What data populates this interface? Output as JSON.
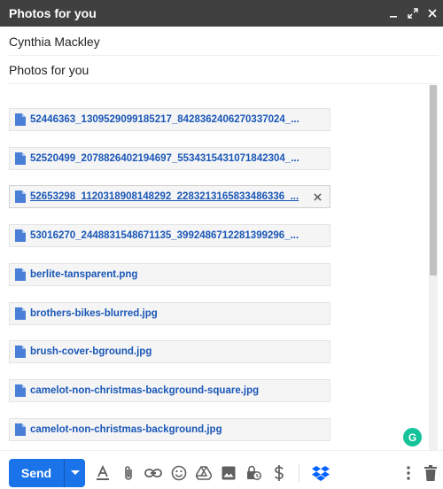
{
  "window": {
    "title": "Photos for you"
  },
  "compose": {
    "to": "Cynthia Mackley",
    "subject": "Photos for you"
  },
  "attachments": [
    {
      "name": "52446363_1309529099185217_8428362406270337024_..."
    },
    {
      "name": "52520499_2078826402194697_5534315431071842304_..."
    },
    {
      "name": "52653298_1120318908148292_2283213165833486336_..."
    },
    {
      "name": "53016270_2448831548671135_3992486712281399296_..."
    },
    {
      "name": "berlite-tansparent.png"
    },
    {
      "name": "brothers-bikes-blurred.jpg"
    },
    {
      "name": "brush-cover-bground.jpg"
    },
    {
      "name": "camelot-non-christmas-background-square.jpg"
    },
    {
      "name": "camelot-non-christmas-background.jpg"
    }
  ],
  "toolbar": {
    "send_label": "Send",
    "grammarly_label": "G"
  },
  "colors": {
    "titlebar": "#404040",
    "send": "#1a73e8",
    "link": "#1a57b7",
    "grammarly": "#15c39a",
    "dropbox": "#0061fe"
  }
}
